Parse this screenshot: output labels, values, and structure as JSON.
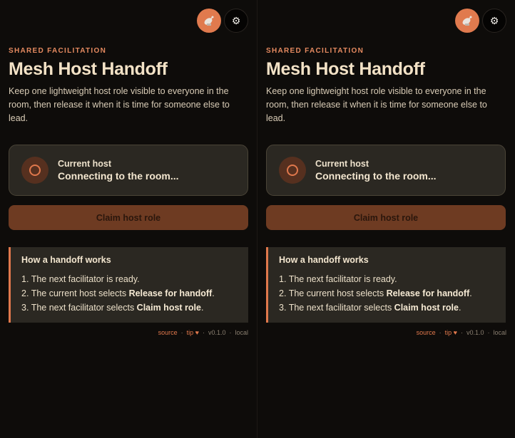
{
  "colors": {
    "accent": "#e0784c",
    "background": "#0e0c0a",
    "card": "#2b2822",
    "button": "#6e3b22"
  },
  "icons": {
    "satellite": "satellite-dish-icon",
    "settings": "gear-icon",
    "status": "status-ring-icon"
  },
  "eyebrow": "SHARED FACILITATION",
  "title": "Mesh Host Handoff",
  "description": "Keep one lightweight host role visible to everyone in the room, then release it when it is time for someone else to lead.",
  "host": {
    "label": "Current host",
    "status": "Connecting to the room..."
  },
  "claim_button": "Claim host role",
  "howto": {
    "title": "How a handoff works",
    "steps": [
      {
        "num": "1.",
        "text": "The next facilitator is ready."
      },
      {
        "num": "2.",
        "pre": "The current host selects ",
        "bold": "Release for handoff",
        "post": "."
      },
      {
        "num": "3.",
        "pre": "The next facilitator selects ",
        "bold": "Claim host role",
        "post": "."
      }
    ]
  },
  "footer": {
    "source": "source",
    "tip": "tip",
    "heart": "♥",
    "version": "v0.1.0",
    "env": "local",
    "sep": "·"
  }
}
